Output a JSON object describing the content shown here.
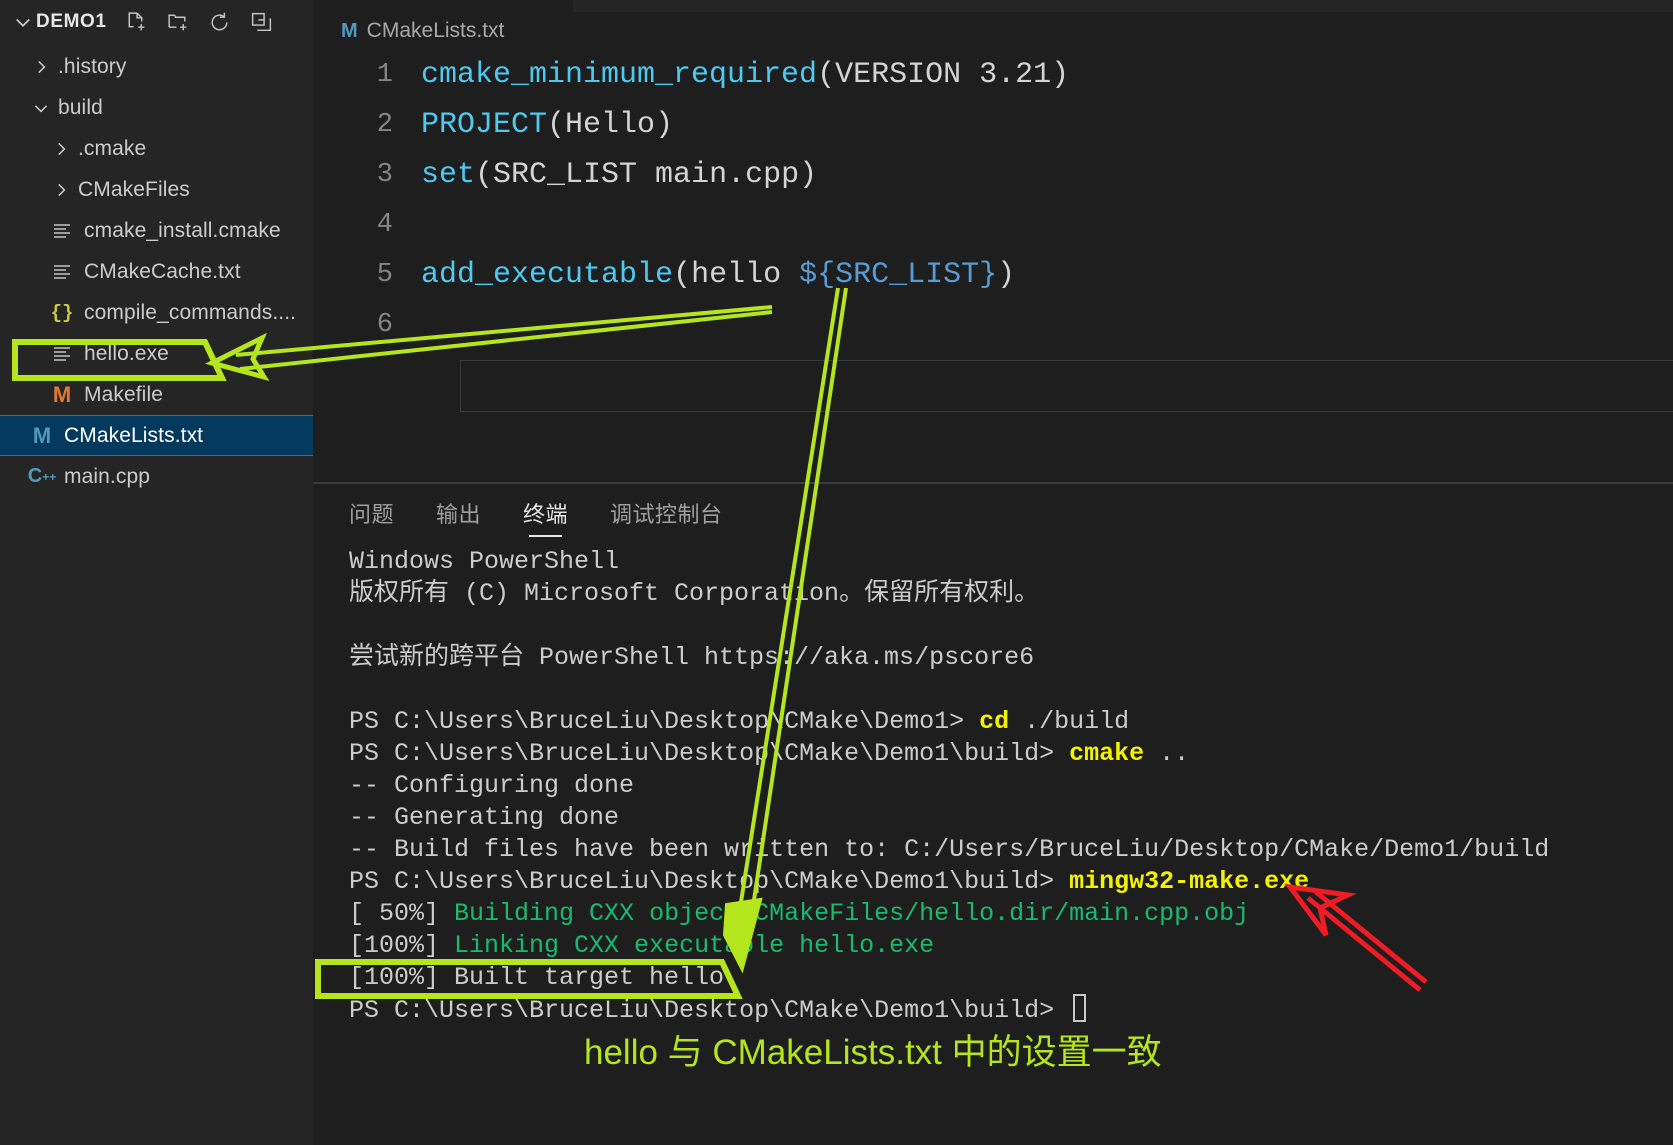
{
  "explorer": {
    "title": "DEMO1",
    "twisty": "chevron-down",
    "actions": [
      {
        "name": "new-file-icon",
        "label": "New File"
      },
      {
        "name": "new-folder-icon",
        "label": "New Folder"
      },
      {
        "name": "refresh-icon",
        "label": "Refresh Explorer"
      },
      {
        "name": "collapse-all-icon",
        "label": "Collapse Folders in Explorer"
      }
    ],
    "items": [
      {
        "label": ".history",
        "indent": 1,
        "type": "folder",
        "expanded": false,
        "selected": false
      },
      {
        "label": "build",
        "indent": 1,
        "type": "folder",
        "expanded": true,
        "selected": false
      },
      {
        "label": ".cmake",
        "indent": 2,
        "type": "folder",
        "expanded": false,
        "selected": false
      },
      {
        "label": "CMakeFiles",
        "indent": 2,
        "type": "folder",
        "expanded": false,
        "selected": false
      },
      {
        "label": "cmake_install.cmake",
        "indent": 2,
        "type": "file-txt",
        "selected": false
      },
      {
        "label": "CMakeCache.txt",
        "indent": 2,
        "type": "file-txt",
        "selected": false
      },
      {
        "label": "compile_commands....",
        "indent": 2,
        "type": "file-json",
        "selected": false
      },
      {
        "label": "hello.exe",
        "indent": 2,
        "type": "file-txt",
        "selected": false,
        "highlighted": true
      },
      {
        "label": "Makefile",
        "indent": 2,
        "type": "file-makefile",
        "selected": false
      },
      {
        "label": "CMakeLists.txt",
        "indent": 1,
        "type": "file-cmake",
        "selected": true
      },
      {
        "label": "main.cpp",
        "indent": 1,
        "type": "file-cpp",
        "selected": false
      }
    ]
  },
  "breadcrumb": {
    "icon": "cmake-file-icon",
    "label": "CMakeLists.txt"
  },
  "editor": {
    "lines": [
      {
        "no": "1",
        "segments": [
          {
            "t": "cmake_minimum_required",
            "c": "fn"
          },
          {
            "t": "(",
            "c": "p"
          },
          {
            "t": "VERSION 3.21",
            "c": "s"
          },
          {
            "t": ")",
            "c": "p"
          }
        ]
      },
      {
        "no": "2",
        "segments": [
          {
            "t": "PROJECT",
            "c": "fn"
          },
          {
            "t": "(",
            "c": "p"
          },
          {
            "t": "Hello",
            "c": "s"
          },
          {
            "t": ")",
            "c": "p"
          }
        ]
      },
      {
        "no": "3",
        "segments": [
          {
            "t": "set",
            "c": "fn"
          },
          {
            "t": "(",
            "c": "p"
          },
          {
            "t": "SRC_LIST main.cpp",
            "c": "s"
          },
          {
            "t": ")",
            "c": "p"
          }
        ]
      },
      {
        "no": "4",
        "segments": []
      },
      {
        "no": "5",
        "segments": [
          {
            "t": "add_executable",
            "c": "fn"
          },
          {
            "t": "(",
            "c": "p"
          },
          {
            "t": "hello ",
            "c": "s"
          },
          {
            "t": "${SRC_LIST}",
            "c": "v"
          },
          {
            "t": ")",
            "c": "p"
          }
        ]
      },
      {
        "no": "6",
        "segments": []
      }
    ]
  },
  "panel": {
    "tabs": [
      {
        "label": "问题",
        "active": false
      },
      {
        "label": "输出",
        "active": false
      },
      {
        "label": "终端",
        "active": true
      },
      {
        "label": "调试控制台",
        "active": false
      }
    ]
  },
  "terminal": {
    "lines": [
      [
        {
          "t": "Windows PowerShell",
          "c": "white"
        }
      ],
      [
        {
          "t": "版权所有 (C) Microsoft Corporation。保留所有权利。",
          "c": "white"
        }
      ],
      [],
      [
        {
          "t": "尝试新的跨平台 PowerShell https://aka.ms/pscore6",
          "c": "white"
        }
      ],
      [],
      [
        {
          "t": "PS C:\\Users\\BruceLiu\\Desktop\\CMake\\Demo1> ",
          "c": "white"
        },
        {
          "t": "cd",
          "c": "yellow"
        },
        {
          "t": " ",
          "c": "white"
        },
        {
          "t": "./build",
          "c": "white"
        }
      ],
      [
        {
          "t": "PS C:\\Users\\BruceLiu\\Desktop\\CMake\\Demo1\\build> ",
          "c": "white"
        },
        {
          "t": "cmake",
          "c": "yellow"
        },
        {
          "t": " ",
          "c": "white"
        },
        {
          "t": "..",
          "c": "white"
        }
      ],
      [
        {
          "t": "-- Configuring done",
          "c": "white"
        }
      ],
      [
        {
          "t": "-- Generating done",
          "c": "white"
        }
      ],
      [
        {
          "t": "-- Build files have been written to: C:/Users/BruceLiu/Desktop/CMake/Demo1/build",
          "c": "white"
        }
      ],
      [
        {
          "t": "PS C:\\Users\\BruceLiu\\Desktop\\CMake\\Demo1\\build> ",
          "c": "white"
        },
        {
          "t": "mingw32-make.exe",
          "c": "yellow"
        }
      ],
      [
        {
          "t": "[ 50%] ",
          "c": "white"
        },
        {
          "t": "Building CXX object CMakeFiles/hello.dir/main.cpp.obj",
          "c": "green"
        }
      ],
      [
        {
          "t": "[100%] ",
          "c": "white"
        },
        {
          "t": "Linking CXX executable hello.exe",
          "c": "green"
        }
      ],
      [
        {
          "t": "[100%] Built target hello",
          "c": "white"
        }
      ],
      [
        {
          "t": "PS C:\\Users\\BruceLiu\\Desktop\\CMake\\Demo1\\build> ",
          "c": "white"
        }
      ]
    ],
    "cursor": "block-cursor"
  },
  "annotations": {
    "note_text": "hello 与 CMakeLists.txt 中的设置一致",
    "green_color": "#b5e61d",
    "red_color": "#ee1c25",
    "highlight_box_hello_exe": "hello.exe",
    "highlight_box_built_target": "[100%] Built target hello",
    "red_arrow_target": "mingw32-make.exe"
  }
}
